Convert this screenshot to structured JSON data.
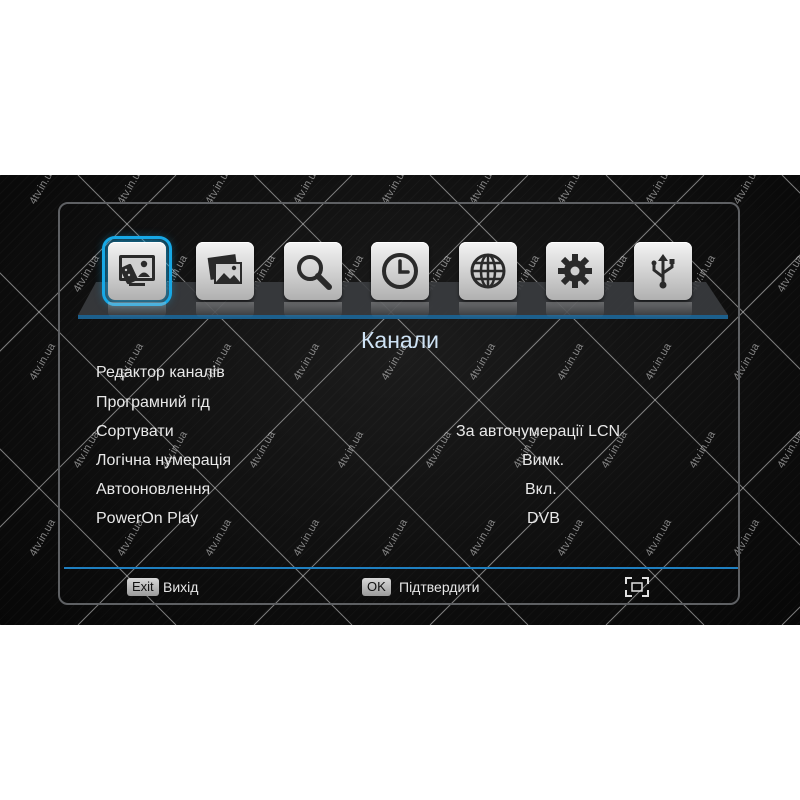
{
  "menu": {
    "icons": [
      {
        "name": "channels-icon",
        "selected": true
      },
      {
        "name": "media-gallery-icon",
        "selected": false
      },
      {
        "name": "search-icon",
        "selected": false
      },
      {
        "name": "clock-icon",
        "selected": false
      },
      {
        "name": "globe-icon",
        "selected": false
      },
      {
        "name": "gear-icon",
        "selected": false
      },
      {
        "name": "usb-icon",
        "selected": false
      }
    ],
    "title": "Канали"
  },
  "settings": [
    {
      "label": "Редактор каналів",
      "value": ""
    },
    {
      "label": "Програмний гід",
      "value": ""
    },
    {
      "label": "Сортувати",
      "value": "За автонумерації LCN"
    },
    {
      "label": "Логічна нумерація",
      "value": "Вимк."
    },
    {
      "label": "Автооновлення",
      "value": "Вкл."
    },
    {
      "label": "PowerOn Play",
      "value": "DVB"
    }
  ],
  "footer": {
    "exit_key": "Exit",
    "exit_label": "Вихід",
    "ok_key": "OK",
    "ok_label": "Підтвердити",
    "resize_icon": "fullscreen-icon"
  },
  "watermark": "4tv.in.ua",
  "colors": {
    "accent": "#17a8e6",
    "divider": "#1f7fc0",
    "title": "#cfe3f5"
  }
}
